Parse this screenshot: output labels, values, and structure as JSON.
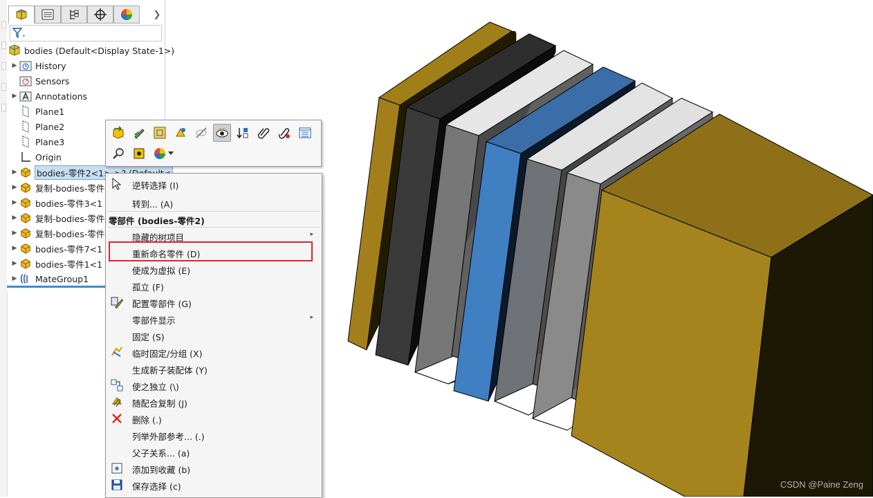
{
  "tree": {
    "tabs": [
      "feature-manager-icon",
      "property-manager-icon",
      "configuration-manager-icon",
      "dimxpert-icon",
      "display-manager-icon"
    ],
    "root": "bodies  (Default<Display State-1>)",
    "items": [
      {
        "label": "History",
        "icon": "history-folder-icon"
      },
      {
        "label": "Sensors",
        "icon": "sensors-icon"
      },
      {
        "label": "Annotations",
        "icon": "annotations-icon"
      },
      {
        "label": "Plane1",
        "icon": "plane-icon"
      },
      {
        "label": "Plane2",
        "icon": "plane-icon"
      },
      {
        "label": "Plane3",
        "icon": "plane-icon"
      },
      {
        "label": "Origin",
        "icon": "origin-icon"
      },
      {
        "label": "bodies-零件2<1>->? (Default<",
        "icon": "part-icon"
      },
      {
        "label": "复制-bodies-零件",
        "icon": "part-icon"
      },
      {
        "label": "bodies-零件3<1",
        "icon": "part-icon"
      },
      {
        "label": "复制-bodies-零件",
        "icon": "part-icon"
      },
      {
        "label": "复制-bodies-零件",
        "icon": "part-icon"
      },
      {
        "label": "bodies-零件7<1",
        "icon": "part-icon"
      },
      {
        "label": "bodies-零件1<1",
        "icon": "part-icon"
      },
      {
        "label": "MateGroup1",
        "icon": "mates-icon"
      }
    ]
  },
  "menu": {
    "items_top": [
      {
        "label": "逆转选择 (I)",
        "icon": "cursor-icon"
      },
      {
        "label": "转到... (A)",
        "icon": ""
      }
    ],
    "header": "零部件 (bodies-零件2)",
    "items": [
      {
        "label": "隐藏的树项目",
        "icon": "",
        "submenu": true
      },
      {
        "label": "重新命名零件 (D)",
        "icon": ""
      },
      {
        "label": "使成为虚拟 (E)",
        "icon": ""
      },
      {
        "label": "孤立 (F)",
        "icon": ""
      },
      {
        "label": "配置零部件 (G)",
        "icon": "pencil-icon"
      },
      {
        "label": "零部件显示",
        "icon": "",
        "submenu": true
      },
      {
        "label": "固定 (S)",
        "icon": ""
      },
      {
        "label": "临时固定/分组 (X)",
        "icon": "temp-fix-icon"
      },
      {
        "label": "生成新子装配体 (Y)",
        "icon": ""
      },
      {
        "label": "使之独立 (\\)",
        "icon": "make-independent-icon"
      },
      {
        "label": "随配合复制 (J)",
        "icon": "copy-with-mates-icon"
      },
      {
        "label": "删除 (.)",
        "icon": "delete-icon"
      },
      {
        "label": "列举外部参考... (.)",
        "icon": ""
      },
      {
        "label": "父子关系... (a)",
        "icon": ""
      },
      {
        "label": "添加到收藏 (b)",
        "icon": "favorite-icon"
      },
      {
        "label": "保存选择 (c)",
        "icon": "save-selection-icon"
      }
    ],
    "submenu_arrow": "▸"
  },
  "toolbar": {
    "row1": [
      "open-part-icon",
      "edit-part-icon",
      "assembly-icon",
      "appearance-icon",
      "hide-icon",
      "visibility-icon",
      "transparency-icon",
      "paperclip-icon",
      "mate-icon",
      "properties-icon"
    ],
    "row2": [
      "zoom-to-selection-icon",
      "view-icon",
      "color-wheel-icon"
    ]
  },
  "colors": {
    "gold": "#9c7c19",
    "black": "#2b2b2b",
    "blue": "#3f7fc2",
    "highlight": "#d9262d",
    "selection": "#c7def3"
  },
  "watermark": "CSDN @Paine Zeng"
}
